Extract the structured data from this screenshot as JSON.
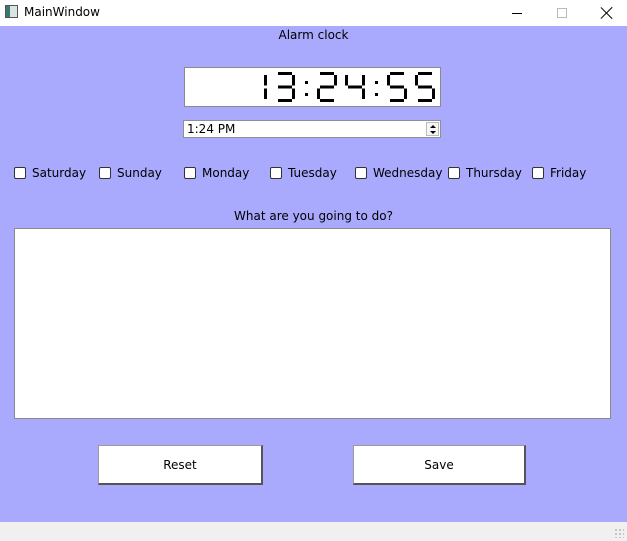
{
  "window": {
    "title": "MainWindow",
    "icon": "app-window-icon",
    "controls": [
      "minimize-icon",
      "maximize-icon",
      "close-icon"
    ]
  },
  "colors": {
    "client_background": "#a9a9fe",
    "titlebar": "#ffffff",
    "lcd_digit": "#000000"
  },
  "header": {
    "title": "Alarm clock"
  },
  "clock": {
    "display": "13:24:55"
  },
  "time_edit": {
    "value": "1:24 PM"
  },
  "days": [
    {
      "label": "Saturday",
      "checked": false
    },
    {
      "label": "Sunday",
      "checked": false
    },
    {
      "label": "Monday",
      "checked": false
    },
    {
      "label": "Tuesday",
      "checked": false
    },
    {
      "label": "Wednesday",
      "checked": false
    },
    {
      "label": "Thursday",
      "checked": false
    },
    {
      "label": "Friday",
      "checked": false
    }
  ],
  "task": {
    "label": "What are you going to do?",
    "value": ""
  },
  "buttons": {
    "reset": "Reset",
    "save": "Save"
  }
}
